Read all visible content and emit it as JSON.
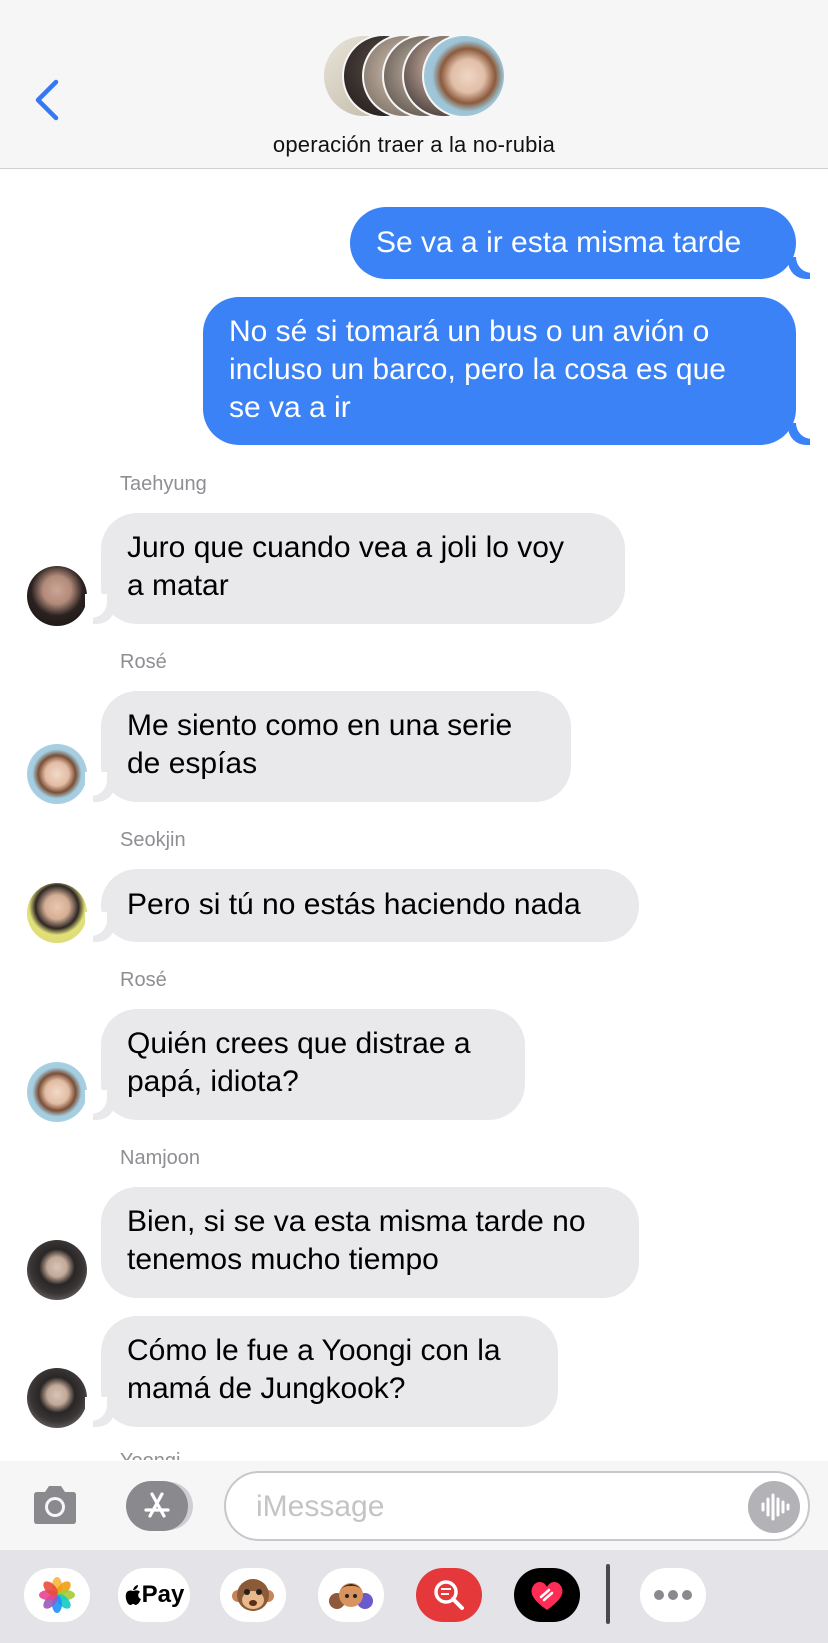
{
  "header": {
    "group_name": "operación traer a la no-rubia",
    "back_label": "<"
  },
  "messages": [
    {
      "direction": "out",
      "text_lines": [
        "Se va a ir esta misma tarde"
      ]
    },
    {
      "direction": "out",
      "text_lines": [
        "No sé si tomará un bus o un avión o",
        "incluso un barco, pero la cosa es que",
        "se va a ir"
      ]
    },
    {
      "direction": "in",
      "sender": "Taehyung",
      "text_lines": [
        "Juro que cuando vea a joli lo voy",
        "a matar"
      ]
    },
    {
      "direction": "in",
      "sender": "Rosé",
      "text_lines": [
        "Me siento como en una serie",
        "de espías"
      ]
    },
    {
      "direction": "in",
      "sender": "Seokjin",
      "text_lines": [
        "Pero si tú no estás haciendo nada"
      ]
    },
    {
      "direction": "in",
      "sender": "Rosé",
      "text_lines": [
        "Quién crees que distrae a",
        "papá, idiota?"
      ]
    },
    {
      "direction": "in",
      "sender": "Namjoon",
      "text_lines": [
        "Bien, si se va esta misma tarde no",
        "tenemos mucho tiempo"
      ]
    },
    {
      "direction": "in",
      "sender": "",
      "text_lines": [
        "Cómo le fue a Yoongi con la",
        "mamá de Jungkook?"
      ]
    }
  ],
  "partially_hidden_sender": "Yoongi",
  "input": {
    "placeholder": "iMessage",
    "value": ""
  },
  "drawer": {
    "apps": [
      "photos-icon",
      "apple-pay-icon",
      "animoji-icon",
      "memoji-icon",
      "image-search-icon",
      "digital-touch-icon",
      "more-icon"
    ],
    "apple_pay_label": "Pay"
  },
  "colors": {
    "outgoing_bubble": "#3a82f6",
    "incoming_bubble": "#e9e9eb",
    "accent": "#3478f6"
  }
}
